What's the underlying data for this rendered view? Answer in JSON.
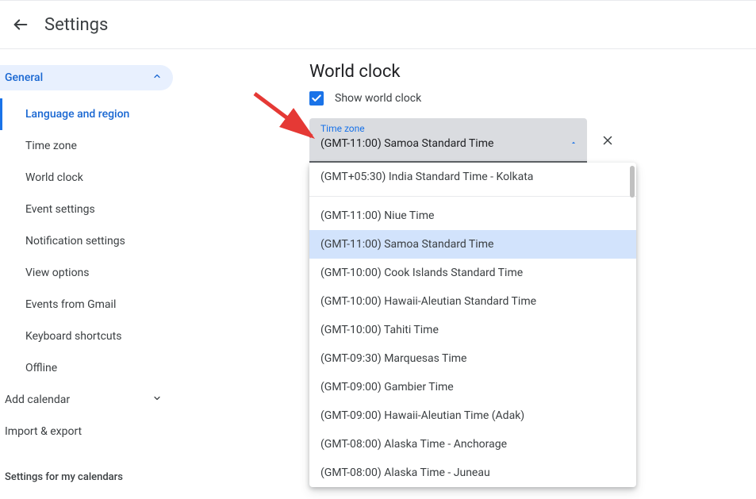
{
  "header": {
    "title": "Settings"
  },
  "sidebar": {
    "general_label": "General",
    "items": [
      "Language and region",
      "Time zone",
      "World clock",
      "Event settings",
      "Notification settings",
      "View options",
      "Events from Gmail",
      "Keyboard shortcuts",
      "Offline"
    ],
    "add_calendar": "Add calendar",
    "import_export": "Import & export",
    "caption": "Settings for my calendars"
  },
  "section": {
    "title": "World clock",
    "checkbox_label": "Show world clock",
    "checkbox_checked": true,
    "tz_field_label": "Time zone",
    "tz_field_value": "(GMT-11:00) Samoa Standard Time"
  },
  "dropdown": {
    "current_value": "(GMT+05:30) India Standard Time - Kolkata",
    "options": [
      "(GMT-11:00) Niue Time",
      "(GMT-11:00) Samoa Standard Time",
      "(GMT-10:00) Cook Islands Standard Time",
      "(GMT-10:00) Hawaii-Aleutian Standard Time",
      "(GMT-10:00) Tahiti Time",
      "(GMT-09:30) Marquesas Time",
      "(GMT-09:00) Gambier Time",
      "(GMT-09:00) Hawaii-Aleutian Time (Adak)",
      "(GMT-08:00) Alaska Time - Anchorage",
      "(GMT-08:00) Alaska Time - Juneau"
    ],
    "selected_index": 1
  }
}
